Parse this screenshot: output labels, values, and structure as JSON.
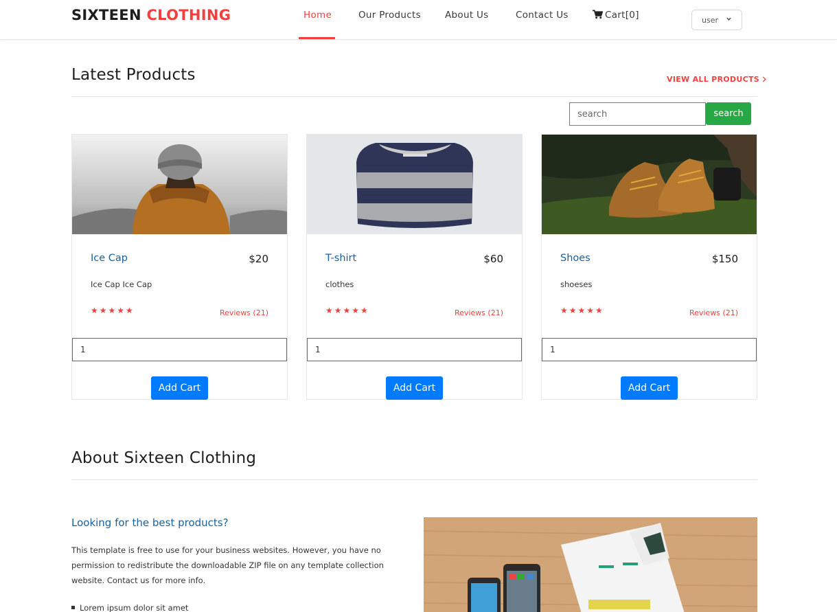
{
  "header": {
    "logo_main": "SIXTEEN",
    "logo_accent": "CLOTHING",
    "nav": [
      {
        "label": "Home"
      },
      {
        "label": "Our Products"
      },
      {
        "label": "About Us"
      },
      {
        "label": "Contact Us"
      },
      {
        "label": "Cart[0]"
      }
    ],
    "user_select": "user"
  },
  "latest": {
    "title": "Latest Products",
    "view_all": "VIEW ALL PRODUCTS",
    "search_placeholder": "search",
    "search_button": "search"
  },
  "products": [
    {
      "name": "Ice Cap",
      "price": "$20",
      "desc": "Ice Cap Ice Cap",
      "stars": "★★★★★",
      "reviews": "Reviews (21)",
      "qty": "1",
      "button": "Add Cart"
    },
    {
      "name": "T-shirt",
      "price": "$60",
      "desc": "clothes",
      "stars": "★★★★★",
      "reviews": "Reviews (21)",
      "qty": "1",
      "button": "Add Cart"
    },
    {
      "name": "Shoes",
      "price": "$150",
      "desc": "shoeses",
      "stars": "★★★★★",
      "reviews": "Reviews (21)",
      "qty": "1",
      "button": "Add Cart"
    }
  ],
  "about": {
    "title": "About Sixteen Clothing",
    "subtitle": "Looking for the best products?",
    "text": "This template is free to use for your business websites. However, you have no permission to redistribute the downloadable ZIP file on any template collection website. Contact us for more info.",
    "bullet": "Lorem ipsum dolor sit amet"
  },
  "colors": {
    "accent": "#f33f3f",
    "link": "#1a5f9c",
    "search_btn": "#28a745",
    "add_btn": "#007bff"
  }
}
